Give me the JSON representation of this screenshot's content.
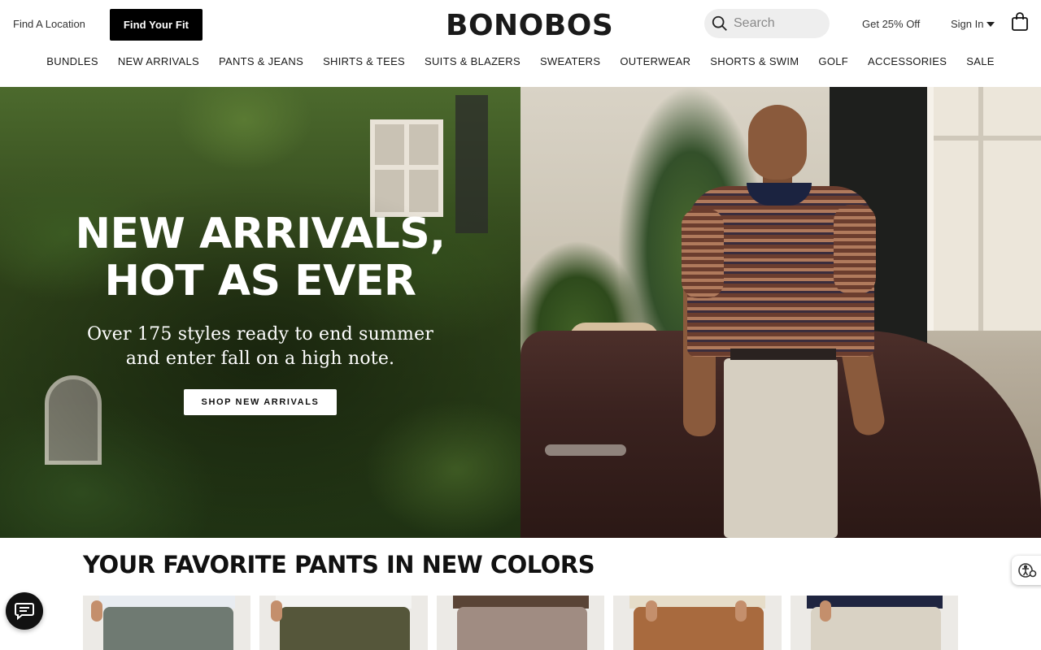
{
  "header": {
    "find_location": "Find A Location",
    "find_fit": "Find Your Fit",
    "logo": "BONOBOS",
    "search_placeholder": "Search",
    "promo": "Get 25% Off",
    "sign_in": "Sign In"
  },
  "nav": {
    "items": [
      {
        "label": "BUNDLES"
      },
      {
        "label": "NEW ARRIVALS"
      },
      {
        "label": "PANTS & JEANS"
      },
      {
        "label": "SHIRTS & TEES"
      },
      {
        "label": "SUITS & BLAZERS"
      },
      {
        "label": "SWEATERS"
      },
      {
        "label": "OUTERWEAR"
      },
      {
        "label": "SHORTS & SWIM"
      },
      {
        "label": "GOLF"
      },
      {
        "label": "ACCESSORIES"
      },
      {
        "label": "SALE"
      }
    ]
  },
  "hero": {
    "title": "NEW ARRIVALS,\nHOT AS EVER",
    "subtitle": "Over 175 styles ready to end summer\nand enter fall on a high note.",
    "cta": "SHOP NEW ARRIVALS"
  },
  "section": {
    "title": "YOUR FAVORITE PANTS IN NEW COLORS",
    "products": [
      {
        "pant_color": "#6f7a72",
        "shirt_color": "#e8ecf1"
      },
      {
        "pant_color": "#55563a",
        "shirt_color": "#f4f4f2"
      },
      {
        "pant_color": "#a08c82",
        "shirt_color": "#5a4436"
      },
      {
        "pant_color": "#a86a3e",
        "shirt_color": "#e6ddc9"
      },
      {
        "pant_color": "#d9d2c4",
        "shirt_color": "#1f2540"
      }
    ]
  },
  "icons": {
    "search": "search-icon",
    "bag": "shopping-bag-icon",
    "caret": "caret-down-icon",
    "chat": "chat-icon",
    "accessibility": "accessibility-icon"
  }
}
